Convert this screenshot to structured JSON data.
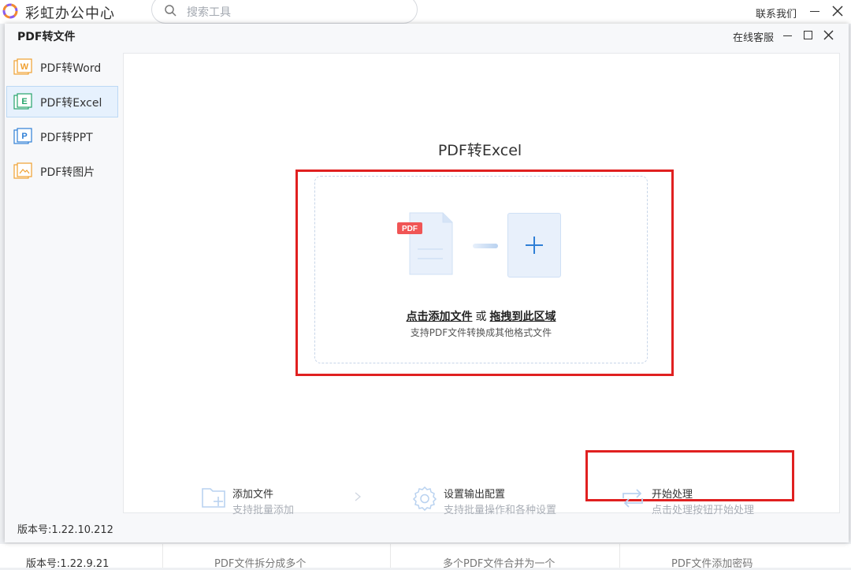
{
  "topbar": {
    "app_title": "彩虹办公中心",
    "search_placeholder": "搜索工具",
    "contact": "联系我们"
  },
  "background": {
    "version": "版本号:1.22.9.21",
    "items": [
      "PDF文件拆分成多个",
      "多个PDF文件合并为一个",
      "PDF文件添加密码"
    ]
  },
  "window": {
    "title": "PDF转文件",
    "online_support": "在线客服",
    "version": "版本号:1.22.10.212"
  },
  "sidebar": {
    "items": [
      {
        "label": "PDF转Word",
        "icon": "word-file-icon",
        "letter": "W",
        "color": "#f0a030",
        "active": false
      },
      {
        "label": "PDF转Excel",
        "icon": "excel-file-icon",
        "letter": "E",
        "color": "#24a46b",
        "active": true
      },
      {
        "label": "PDF转PPT",
        "icon": "ppt-file-icon",
        "letter": "P",
        "color": "#2f7fd6",
        "active": false
      },
      {
        "label": "PDF转图片",
        "icon": "image-file-icon",
        "letter": "",
        "color": "#f0a030",
        "active": false
      }
    ]
  },
  "main": {
    "title": "PDF转Excel",
    "drop": {
      "pdf_badge": "PDF",
      "click_add": "点击添加文件",
      "or": "或",
      "drag_here": "拖拽到此区域",
      "subtitle": "支持PDF文件转换成其他格式文件"
    },
    "steps": [
      {
        "title": "添加文件",
        "desc": "支持批量添加",
        "icon": "add-folder-icon"
      },
      {
        "title": "设置输出配置",
        "desc": "支持批量操作和各种设置",
        "icon": "settings-gear-icon"
      },
      {
        "title": "开始处理",
        "desc": "点击处理按钮开始处理",
        "icon": "process-cycle-icon"
      }
    ]
  },
  "colors": {
    "accent": "#2f7fd6",
    "highlight_red": "#e02020",
    "active_bg": "#e6f1fd",
    "icon_light_blue": "#cfe0f5"
  }
}
